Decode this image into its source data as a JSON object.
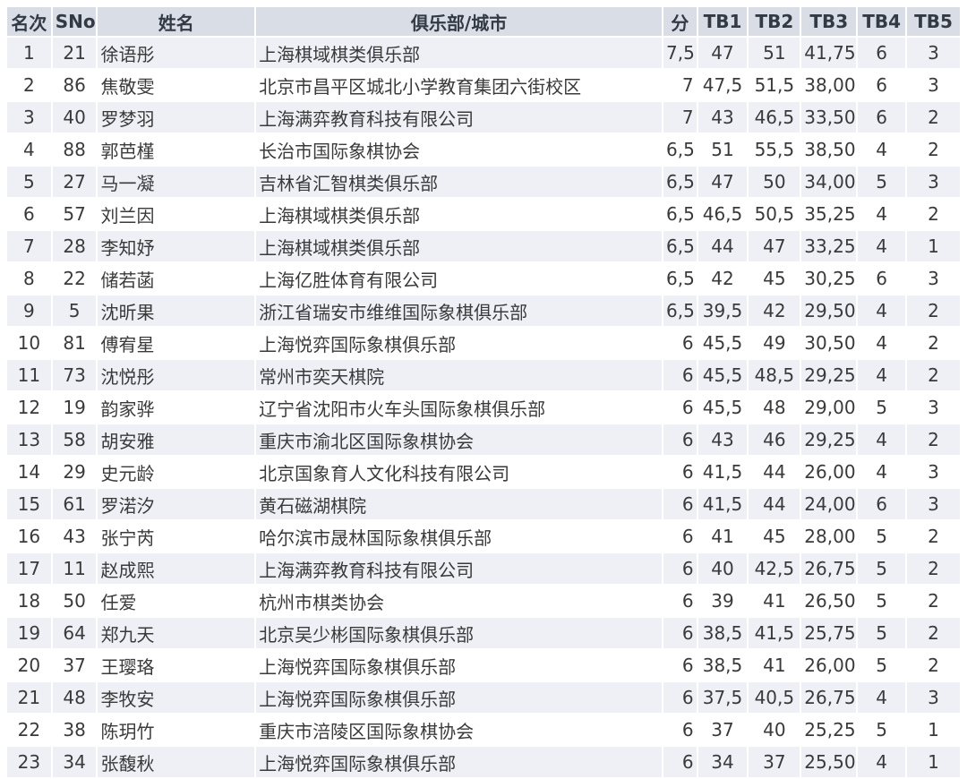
{
  "headers": {
    "rank": "名次",
    "sno": "SNo",
    "name": "姓名",
    "club": "俱乐部/城市",
    "points": "分",
    "tb1": "TB1",
    "tb2": "TB2",
    "tb3": "TB3",
    "tb4": "TB4",
    "tb5": "TB5"
  },
  "rows": [
    {
      "rank": "1",
      "sno": "21",
      "name": "徐语彤",
      "club": "上海棋域棋类俱乐部",
      "points": "7,5",
      "tb1": "47",
      "tb2": "51",
      "tb3": "41,75",
      "tb4": "6",
      "tb5": "3"
    },
    {
      "rank": "2",
      "sno": "86",
      "name": "焦敬雯",
      "club": "北京市昌平区城北小学教育集团六街校区",
      "points": "7",
      "tb1": "47,5",
      "tb2": "51,5",
      "tb3": "38,00",
      "tb4": "6",
      "tb5": "3"
    },
    {
      "rank": "3",
      "sno": "40",
      "name": "罗梦羽",
      "club": "上海满弈教育科技有限公司",
      "points": "7",
      "tb1": "43",
      "tb2": "46,5",
      "tb3": "33,50",
      "tb4": "6",
      "tb5": "2"
    },
    {
      "rank": "4",
      "sno": "88",
      "name": "郭芭槿",
      "club": "长治市国际象棋协会",
      "points": "6,5",
      "tb1": "51",
      "tb2": "55,5",
      "tb3": "38,50",
      "tb4": "4",
      "tb5": "2"
    },
    {
      "rank": "5",
      "sno": "27",
      "name": "马一凝",
      "club": "吉林省汇智棋类俱乐部",
      "points": "6,5",
      "tb1": "47",
      "tb2": "50",
      "tb3": "34,00",
      "tb4": "5",
      "tb5": "3"
    },
    {
      "rank": "6",
      "sno": "57",
      "name": "刘兰因",
      "club": "上海棋域棋类俱乐部",
      "points": "6,5",
      "tb1": "46,5",
      "tb2": "50,5",
      "tb3": "35,25",
      "tb4": "4",
      "tb5": "2"
    },
    {
      "rank": "7",
      "sno": "28",
      "name": "李知妤",
      "club": "上海棋域棋类俱乐部",
      "points": "6,5",
      "tb1": "44",
      "tb2": "47",
      "tb3": "33,25",
      "tb4": "4",
      "tb5": "1"
    },
    {
      "rank": "8",
      "sno": "22",
      "name": "储若菡",
      "club": "上海亿胜体育有限公司",
      "points": "6,5",
      "tb1": "42",
      "tb2": "45",
      "tb3": "30,25",
      "tb4": "6",
      "tb5": "3"
    },
    {
      "rank": "9",
      "sno": "5",
      "name": "沈昕果",
      "club": "浙江省瑞安市维维国际象棋俱乐部",
      "points": "6,5",
      "tb1": "39,5",
      "tb2": "42",
      "tb3": "29,50",
      "tb4": "4",
      "tb5": "2"
    },
    {
      "rank": "10",
      "sno": "81",
      "name": "傅宥星",
      "club": "上海悦弈国际象棋俱乐部",
      "points": "6",
      "tb1": "45,5",
      "tb2": "49",
      "tb3": "30,50",
      "tb4": "4",
      "tb5": "2"
    },
    {
      "rank": "11",
      "sno": "73",
      "name": "沈悦彤",
      "club": "常州市奕天棋院",
      "points": "6",
      "tb1": "45,5",
      "tb2": "48,5",
      "tb3": "29,25",
      "tb4": "4",
      "tb5": "2"
    },
    {
      "rank": "12",
      "sno": "19",
      "name": "韵家骅",
      "club": "辽宁省沈阳市火车头国际象棋俱乐部",
      "points": "6",
      "tb1": "45,5",
      "tb2": "48",
      "tb3": "29,00",
      "tb4": "5",
      "tb5": "3"
    },
    {
      "rank": "13",
      "sno": "58",
      "name": "胡安雅",
      "club": "重庆市渝北区国际象棋协会",
      "points": "6",
      "tb1": "43",
      "tb2": "46",
      "tb3": "29,25",
      "tb4": "4",
      "tb5": "2"
    },
    {
      "rank": "14",
      "sno": "29",
      "name": "史元龄",
      "club": "北京国象育人文化科技有限公司",
      "points": "6",
      "tb1": "41,5",
      "tb2": "44",
      "tb3": "26,00",
      "tb4": "4",
      "tb5": "3"
    },
    {
      "rank": "15",
      "sno": "61",
      "name": "罗渃汐",
      "club": "黄石磁湖棋院",
      "points": "6",
      "tb1": "41,5",
      "tb2": "44",
      "tb3": "24,00",
      "tb4": "6",
      "tb5": "3"
    },
    {
      "rank": "16",
      "sno": "43",
      "name": "张宁芮",
      "club": "哈尔滨市晟林国际象棋俱乐部",
      "points": "6",
      "tb1": "41",
      "tb2": "45",
      "tb3": "28,00",
      "tb4": "5",
      "tb5": "2"
    },
    {
      "rank": "17",
      "sno": "11",
      "name": "赵成熙",
      "club": "上海满弈教育科技有限公司",
      "points": "6",
      "tb1": "40",
      "tb2": "42,5",
      "tb3": "26,75",
      "tb4": "5",
      "tb5": "2"
    },
    {
      "rank": "18",
      "sno": "50",
      "name": "任爱",
      "club": "杭州市棋类协会",
      "points": "6",
      "tb1": "39",
      "tb2": "41",
      "tb3": "26,50",
      "tb4": "5",
      "tb5": "2"
    },
    {
      "rank": "19",
      "sno": "64",
      "name": "郑九天",
      "club": "北京吴少彬国际象棋俱乐部",
      "points": "6",
      "tb1": "38,5",
      "tb2": "41,5",
      "tb3": "25,75",
      "tb4": "5",
      "tb5": "2"
    },
    {
      "rank": "20",
      "sno": "37",
      "name": "王璎珞",
      "club": "上海悦弈国际象棋俱乐部",
      "points": "6",
      "tb1": "38,5",
      "tb2": "41",
      "tb3": "26,00",
      "tb4": "5",
      "tb5": "2"
    },
    {
      "rank": "21",
      "sno": "48",
      "name": "李牧安",
      "club": "上海悦弈国际象棋俱乐部",
      "points": "6",
      "tb1": "37,5",
      "tb2": "40,5",
      "tb3": "26,75",
      "tb4": "4",
      "tb5": "3"
    },
    {
      "rank": "22",
      "sno": "38",
      "name": "陈玥竹",
      "club": "重庆市涪陵区国际象棋协会",
      "points": "6",
      "tb1": "37",
      "tb2": "40",
      "tb3": "25,25",
      "tb4": "5",
      "tb5": "1"
    },
    {
      "rank": "23",
      "sno": "34",
      "name": "张馥秋",
      "club": "上海悦弈国际象棋俱乐部",
      "points": "6",
      "tb1": "34",
      "tb2": "37",
      "tb3": "25,50",
      "tb4": "4",
      "tb5": "1"
    }
  ]
}
